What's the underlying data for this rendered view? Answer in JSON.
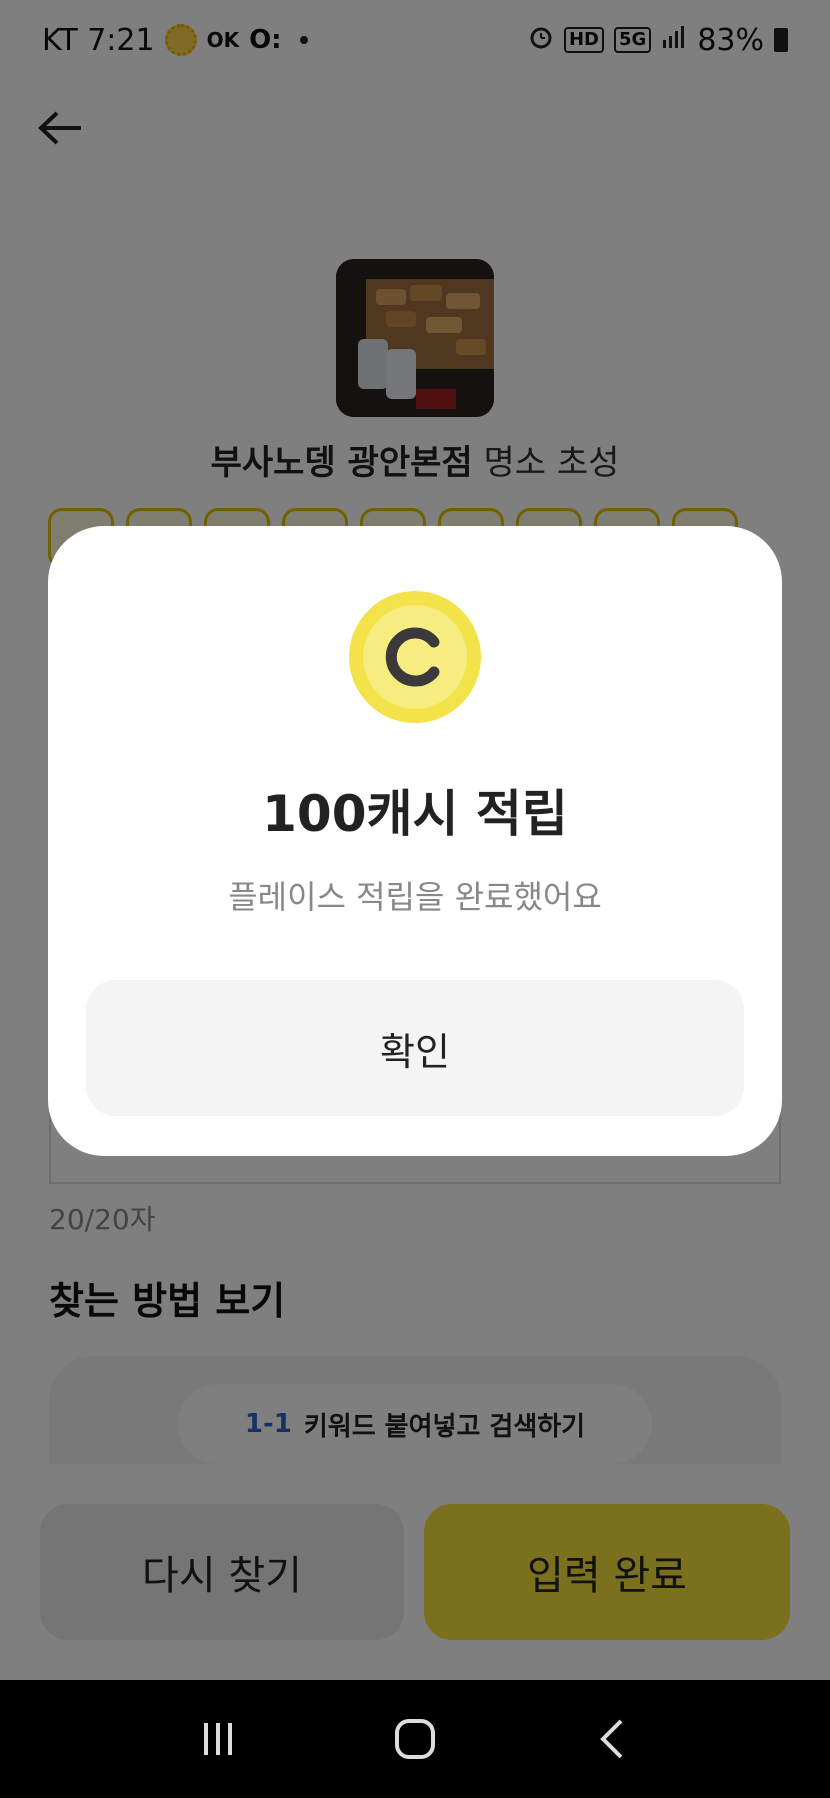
{
  "status_bar": {
    "carrier_time": "KT 7:21",
    "ok_label": "OK",
    "o_label": "O:",
    "hd_label": "HD",
    "network_label": "5G",
    "battery": "83%"
  },
  "place": {
    "name": "부사노뎅 광안본점",
    "subtitle": "명소 초성"
  },
  "input": {
    "char_count": "20/20자"
  },
  "guide": {
    "title": "찾는 방법 보기",
    "step_number": "1-1",
    "step_text": "키워드 붙여넣고 검색하기"
  },
  "buttons": {
    "retry": "다시 찾기",
    "done": "입력 완료"
  },
  "modal": {
    "title": "100캐시 적립",
    "subtitle": "플레이스 적립을 완료했어요",
    "confirm": "확인"
  },
  "colors": {
    "accent_yellow": "#f6e13a",
    "step_blue": "#2d62c9",
    "coin_yellow": "#f7e64a"
  },
  "icons": {
    "back": "arrow-left-icon",
    "coin": "coin-c-icon",
    "nav_recent": "recent-apps-icon",
    "nav_home": "home-icon",
    "nav_back": "chevron-left-icon"
  }
}
